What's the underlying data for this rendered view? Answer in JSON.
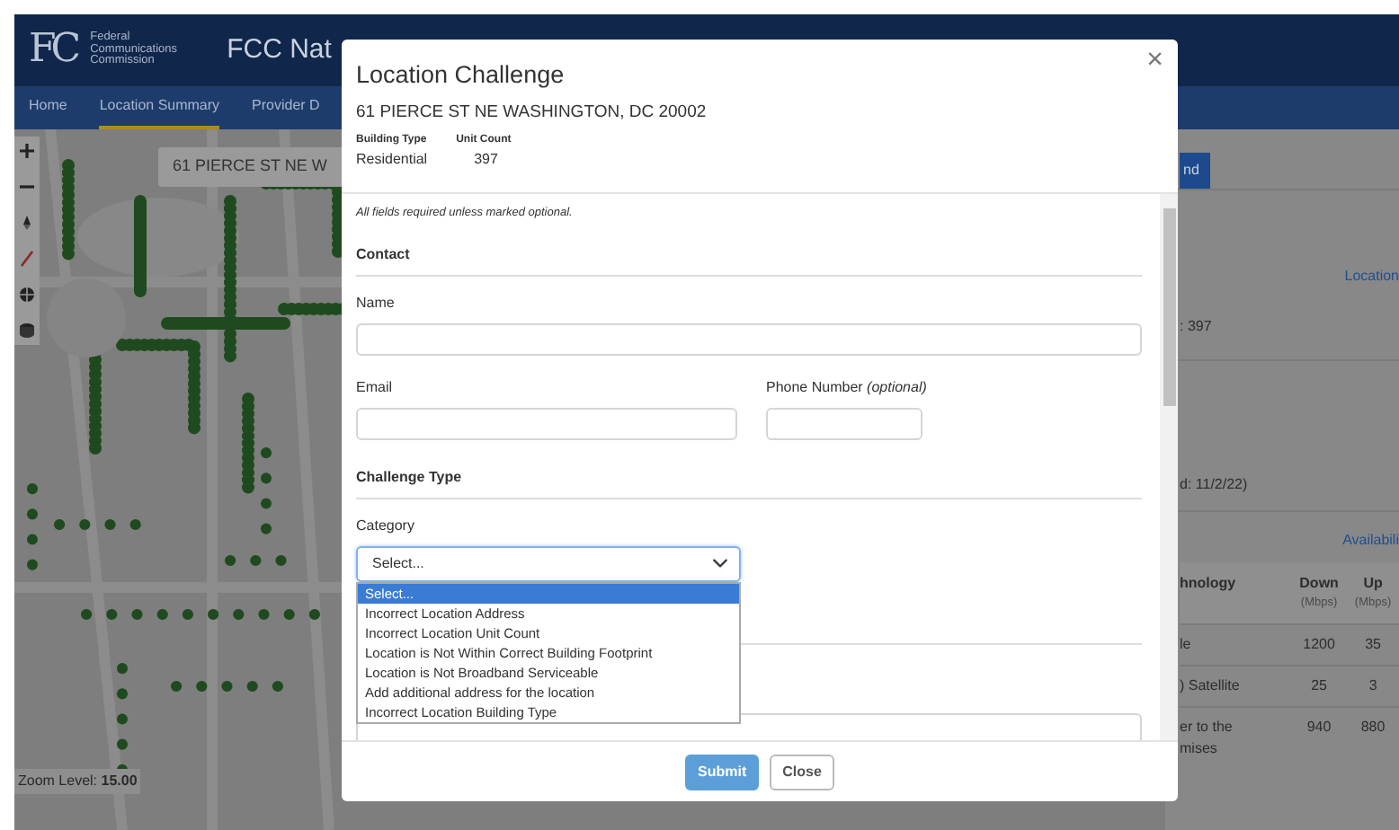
{
  "header": {
    "logo": "FC",
    "agency": "Federal Communications Commission",
    "title": "FCC Nat"
  },
  "nav": [
    {
      "label": "Home",
      "selected": false
    },
    {
      "label": "Location Summary",
      "selected": true
    },
    {
      "label": "Provider D",
      "selected": false
    }
  ],
  "map": {
    "search_value": "61 PIERCE ST NE W",
    "zoom_level": "Zoom Level: **15.00**"
  },
  "side_panel": {
    "button": "nd",
    "location_link": "Location",
    "unit_count": ": 397",
    "updated": "d: 11/2/22)",
    "availability_link": "Availabili",
    "table": {
      "columns": [
        {
          "label": "hnology"
        },
        {
          "label": "Down",
          "unit": "(Mbps)"
        },
        {
          "label": "Up",
          "unit": "(Mbps)"
        }
      ],
      "rows": [
        [
          "le",
          "1200",
          "35"
        ],
        [
          ") Satellite",
          "25",
          "3"
        ],
        [
          "er to the mises",
          "940",
          "880"
        ]
      ]
    }
  },
  "modal": {
    "title": "Location Challenge",
    "close": "×",
    "address": "61 PIERCE ST NE WASHINGTON, DC 20002",
    "facts": [
      {
        "label": "Building Type",
        "value": "Residential"
      },
      {
        "label": "Unit Count",
        "value": "397"
      }
    ],
    "note": "All fields required unless marked optional.",
    "contact": {
      "heading": "Contact",
      "fields": [
        {
          "label": "Name"
        },
        {
          "label": "Email"
        },
        {
          "label": "Phone Number *(optional)*"
        }
      ]
    },
    "challenge": {
      "heading": "Challenge Type",
      "category_label": "Category",
      "select_value": "Select...",
      "options": [
        {
          "label": "Select...",
          "selected": true
        },
        {
          "label": "Incorrect Location Address",
          "selected": false
        },
        {
          "label": "Incorrect Location Unit Count",
          "selected": false
        },
        {
          "label": "Location is Not Within Correct Building Footprint",
          "selected": false
        },
        {
          "label": "Location is Not Broadband Serviceable",
          "selected": false
        },
        {
          "label": "Add additional address for the location",
          "selected": false
        },
        {
          "label": "Incorrect Location Building Type",
          "selected": false
        }
      ]
    },
    "buttons": [
      {
        "label": "Submit",
        "kind": "primary"
      },
      {
        "label": "Close",
        "kind": "secondary"
      }
    ]
  }
}
